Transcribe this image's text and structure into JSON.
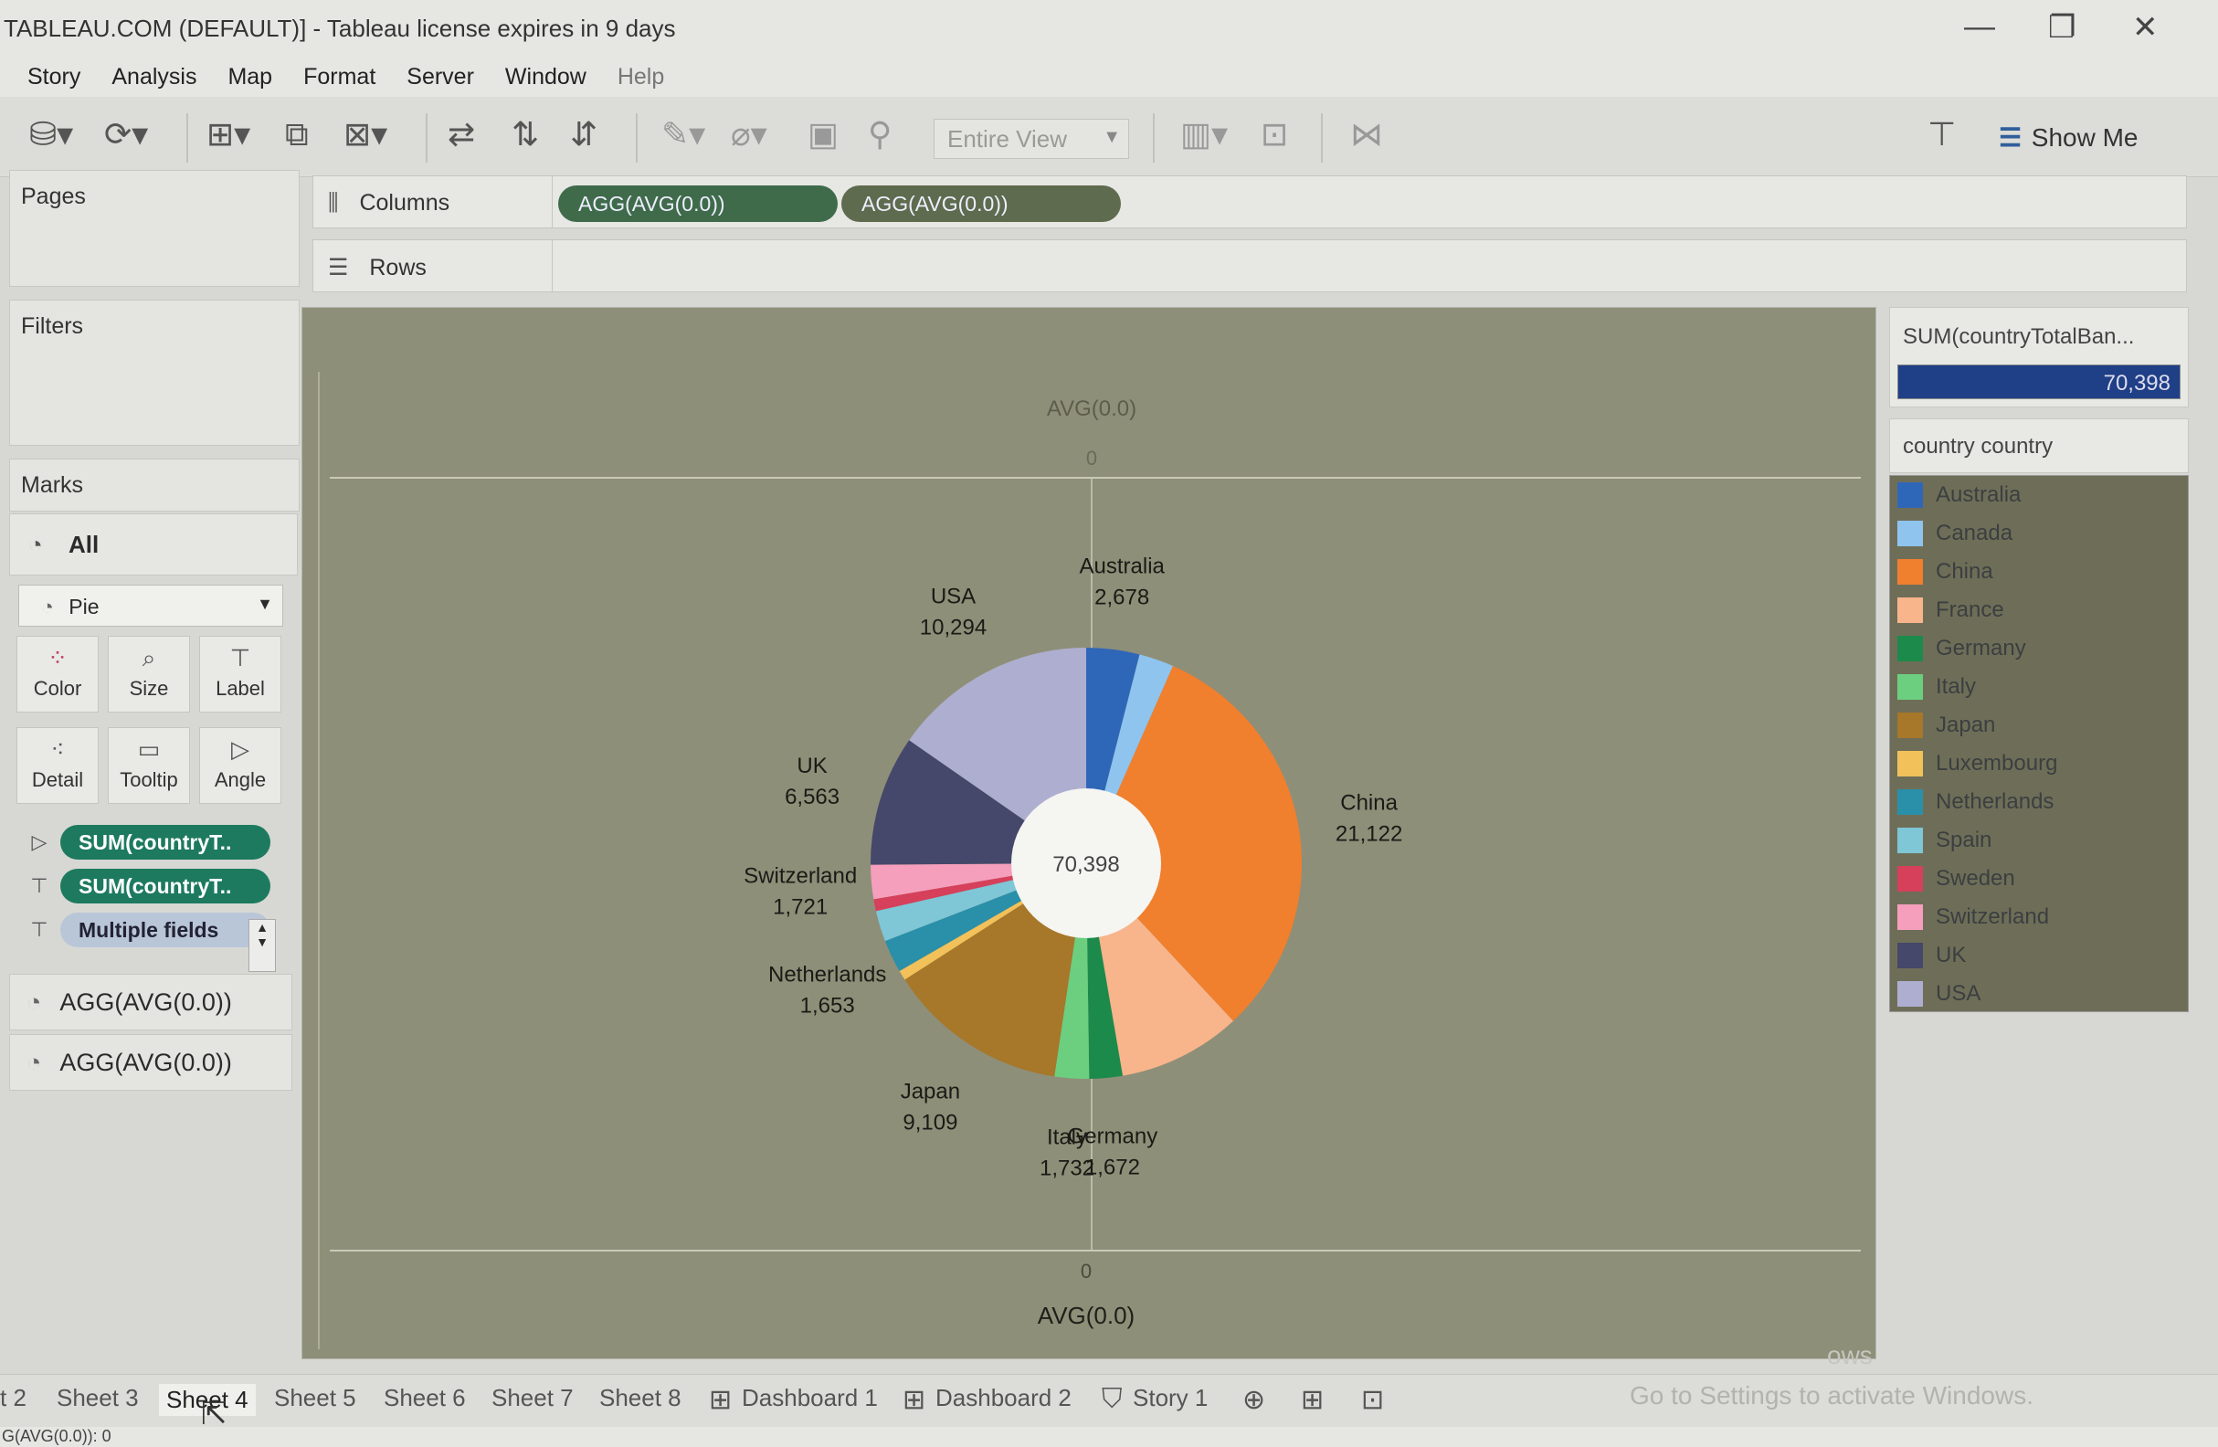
{
  "window": {
    "title": "TABLEAU.COM (DEFAULT)] - Tableau license expires in 9 days",
    "minimize": "—",
    "restore": "❐",
    "close": "✕"
  },
  "menu": [
    "Story",
    "Analysis",
    "Map",
    "Format",
    "Server",
    "Window",
    "Help"
  ],
  "toolbar": {
    "fit_label": "Entire View",
    "show_me_label": "Show Me"
  },
  "panels": {
    "pages": "Pages",
    "filters": "Filters",
    "marks": "Marks"
  },
  "marks": {
    "all_label": "All",
    "mark_type": "Pie",
    "cards": [
      "Color",
      "Size",
      "Label",
      "Detail",
      "Tooltip",
      "Angle"
    ],
    "pills": [
      "SUM(countryT..",
      "SUM(countryT..",
      "Multiple fields"
    ],
    "agg_rows": [
      "AGG(AVG(0.0))",
      "AGG(AVG(0.0))"
    ]
  },
  "shelves": {
    "columns_label": "Columns",
    "rows_label": "Rows",
    "column_pills": [
      "AGG(AVG(0.0))",
      "AGG(AVG(0.0))"
    ]
  },
  "legend": {
    "size_title": "SUM(countryTotalBan...",
    "size_value": "70,398",
    "color_title": "country country",
    "items": [
      {
        "name": "Australia",
        "color": "#2f67b8"
      },
      {
        "name": "Canada",
        "color": "#8fc4ee"
      },
      {
        "name": "China",
        "color": "#f07f2e"
      },
      {
        "name": "France",
        "color": "#f8b48a"
      },
      {
        "name": "Germany",
        "color": "#1c8a4a"
      },
      {
        "name": "Italy",
        "color": "#6ccf80"
      },
      {
        "name": "Japan",
        "color": "#a7772a"
      },
      {
        "name": "Luxembourg",
        "color": "#f2c15a"
      },
      {
        "name": "Netherlands",
        "color": "#2a8fa8"
      },
      {
        "name": "Spain",
        "color": "#7fc6d6"
      },
      {
        "name": "Sweden",
        "color": "#d6405a"
      },
      {
        "name": "Switzerland",
        "color": "#f59fbc"
      },
      {
        "name": "UK",
        "color": "#45486a"
      },
      {
        "name": "USA",
        "color": "#aeaed0"
      }
    ]
  },
  "chart_data": {
    "type": "pie",
    "center_label": "70,398",
    "top_axis_title": "AVG(0.0)",
    "bottom_axis_title": "AVG(0.0)",
    "top_tick": "0",
    "bottom_tick": "0",
    "slices": [
      {
        "name": "Australia",
        "value": 2678,
        "label": "2,678",
        "color": "#2f67b8"
      },
      {
        "name": "Canada",
        "value": 1750,
        "label": "",
        "color": "#8fc4ee"
      },
      {
        "name": "China",
        "value": 21122,
        "label": "21,122",
        "color": "#f07f2e"
      },
      {
        "name": "France",
        "value": 6200,
        "label": "",
        "color": "#f8b48a"
      },
      {
        "name": "Germany",
        "value": 1672,
        "label": "1,672",
        "color": "#1c8a4a"
      },
      {
        "name": "Italy",
        "value": 1732,
        "label": "1,732",
        "color": "#6ccf80"
      },
      {
        "name": "Japan",
        "value": 9109,
        "label": "9,109",
        "color": "#a7772a"
      },
      {
        "name": "Luxembourg",
        "value": 500,
        "label": "",
        "color": "#f2c15a"
      },
      {
        "name": "Netherlands",
        "value": 1653,
        "label": "1,653",
        "color": "#2a8fa8"
      },
      {
        "name": "Spain",
        "value": 1550,
        "label": "",
        "color": "#7fc6d6"
      },
      {
        "name": "Sweden",
        "value": 600,
        "label": "",
        "color": "#d6405a"
      },
      {
        "name": "Switzerland",
        "value": 1721,
        "label": "1,721",
        "color": "#f59fbc"
      },
      {
        "name": "UK",
        "value": 6563,
        "label": "6,563",
        "color": "#45486a"
      },
      {
        "name": "USA",
        "value": 10294,
        "label": "10,294",
        "color": "#aeaed0"
      }
    ]
  },
  "tabs": [
    "t 2",
    "Sheet 3",
    "Sheet 4",
    "Sheet 5",
    "Sheet 6",
    "Sheet 7",
    "Sheet 8",
    "Dashboard 1",
    "Dashboard 2",
    "Story 1"
  ],
  "active_tab": "Sheet 4",
  "watermark": {
    "line1": "ows",
    "line2": "Go to Settings to activate Windows."
  },
  "status": "G(AVG(0.0)): 0"
}
